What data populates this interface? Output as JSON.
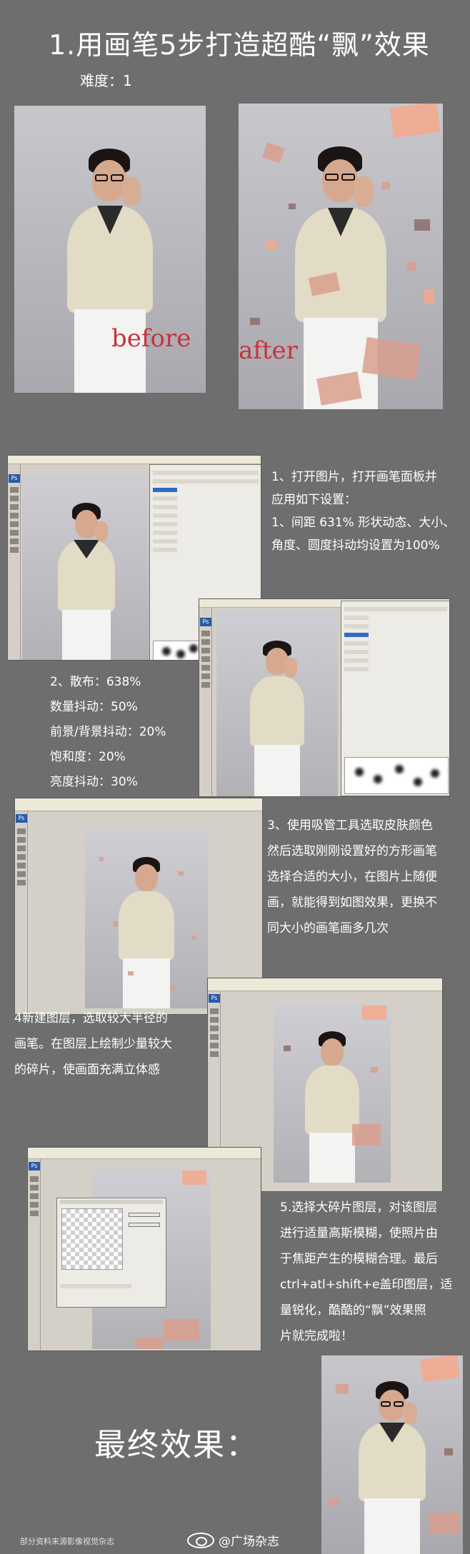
{
  "header": {
    "title": "1.用画笔5步打造超酷“飘”效果",
    "difficulty": "难度：1"
  },
  "labels": {
    "before": "before",
    "after": "after"
  },
  "steps": {
    "step1": [
      "1、打开图片，打开画笔面板并",
      "应用如下设置：",
      "1、间距 631% 形状动态、大小、",
      "角度、圆度抖动均设置为100%"
    ],
    "step2": [
      "2、散布：638%",
      "数量抖动：50%",
      "前景/背景抖动：20%",
      "饱和度：20%",
      "亮度抖动：30%"
    ],
    "step3": [
      "3、使用吸管工具选取皮肤颜色",
      "然后选取刚刚设置好的方形画笔",
      "选择合适的大小，在图片上随便",
      "画，就能得到如图效果，更换不",
      "同大小的画笔画多几次"
    ],
    "step4": [
      "4新建图层，选取较大半径的",
      "画笔。在图层上绘制少量较大",
      "的碎片，使画面充满立体感"
    ],
    "step5": [
      "5.选择大碎片图层，对该图层",
      "进行适量高斯模糊，使照片由",
      "于焦距产生的模糊合理。最后",
      "ctrl+atl+shift+e盖印图层，适",
      "量锐化，酷酷的“飘”效果照",
      "片就完成啦！"
    ]
  },
  "final": {
    "title": "最终效果："
  },
  "footer": {
    "source_note": "部分资料来源影像视觉杂志",
    "weibo_handle": "@广场杂志"
  },
  "colors": {
    "background": "#6e6e6e",
    "label_red": "#c8323a",
    "fragment": "#d99f8d"
  }
}
